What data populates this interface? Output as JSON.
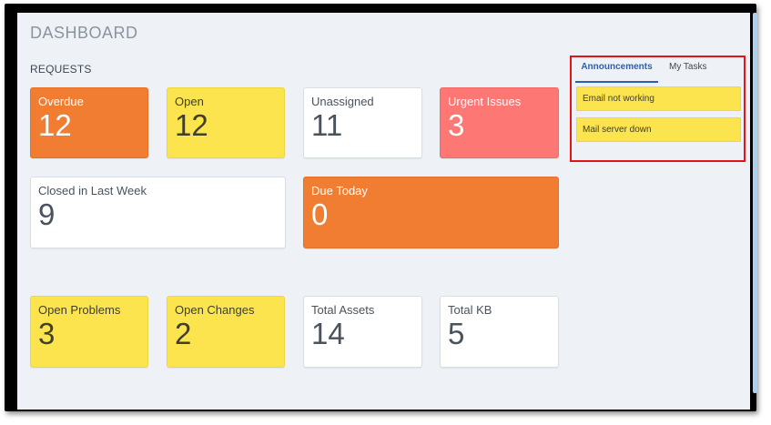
{
  "page": {
    "title": "DASHBOARD",
    "section": "REQUESTS"
  },
  "cards_row1": [
    {
      "label": "Overdue",
      "value": "12",
      "color": "#f07d31"
    },
    {
      "label": "Open",
      "value": "12",
      "color": "#fce44e"
    },
    {
      "label": "Unassigned",
      "value": "11",
      "color": "#ffffff"
    },
    {
      "label": "Urgent Issues",
      "value": "3",
      "color": "#fd7775"
    }
  ],
  "cards_row2": [
    {
      "label": "Closed in Last Week",
      "value": "9",
      "color": "#ffffff"
    },
    {
      "label": "Due Today",
      "value": "0",
      "color": "#f07d31"
    }
  ],
  "cards_row3": [
    {
      "label": "Open Problems",
      "value": "3",
      "color": "#fce44e"
    },
    {
      "label": "Open Changes",
      "value": "2",
      "color": "#fce44e"
    },
    {
      "label": "Total Assets",
      "value": "14",
      "color": "#ffffff"
    },
    {
      "label": "Total KB",
      "value": "5",
      "color": "#ffffff"
    }
  ],
  "panel": {
    "tabs": [
      {
        "label": "Announcements",
        "active": true
      },
      {
        "label": "My Tasks",
        "active": false
      }
    ],
    "announcements": [
      {
        "text": "Email not working"
      },
      {
        "text": "Mail server down"
      }
    ],
    "highlight_color": "#e2141a"
  }
}
